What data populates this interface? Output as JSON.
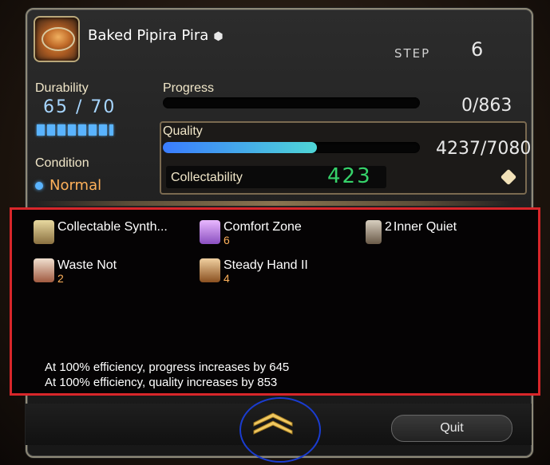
{
  "header": {
    "item_name": "Baked Pipira Pira",
    "hq_glyph": "⬢",
    "step_label": "STEP",
    "step_value": "6"
  },
  "durability": {
    "label": "Durability",
    "current": "65",
    "separator": "/",
    "max": "70",
    "level": 0.93
  },
  "condition": {
    "label": "Condition",
    "value": "Normal"
  },
  "progress": {
    "label": "Progress",
    "value": "0/863",
    "fraction": 0
  },
  "quality": {
    "label": "Quality",
    "value": "4237/7080",
    "fraction": 0.598
  },
  "collectability": {
    "label": "Collectability",
    "value": "423"
  },
  "statuses": [
    {
      "name": "Collectable Synth...",
      "stack": "",
      "prestack": ""
    },
    {
      "name": "Comfort Zone",
      "stack": "6",
      "prestack": ""
    },
    {
      "name": "Inner Quiet",
      "stack": "",
      "prestack": "2"
    },
    {
      "name": "Waste Not",
      "stack": "2",
      "prestack": ""
    },
    {
      "name": "Steady Hand II",
      "stack": "4",
      "prestack": ""
    }
  ],
  "efficiency": {
    "progress_line": "At 100% efficiency, progress increases by 645",
    "quality_line": "At 100% efficiency, quality increases by 853"
  },
  "buttons": {
    "quit_label": "Quit"
  },
  "colors": {
    "durability_blue": "#5ab4ff",
    "condition_orange": "#ffb15a",
    "collectability_green": "#36d26a",
    "highlight_red": "#d8262a",
    "annotation_blue": "#1a3ccf"
  }
}
